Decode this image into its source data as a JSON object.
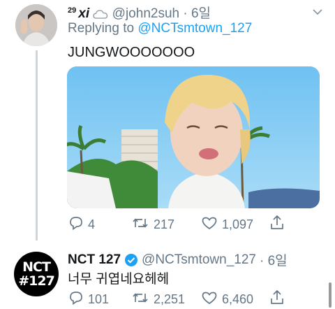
{
  "tweet1": {
    "rank": "29",
    "name": "xi",
    "handle": "@john2suh",
    "time": "· 6일",
    "replying_prefix": "Replying to",
    "replying_handle": "@NCTsmtown_127",
    "text": "JUNGWOOOOOOO",
    "replies": "4",
    "retweets": "217",
    "likes": "1,097"
  },
  "tweet2": {
    "name": "NCT 127",
    "verified": true,
    "handle": "@NCTsmtown_127",
    "time": "· 6일",
    "text": "너무 귀엽네요헤헤",
    "avatar_line1": "NCT",
    "avatar_line2": "#127",
    "replies": "101",
    "retweets": "2,251",
    "likes": "6,460"
  },
  "colors": {
    "accent": "#1da1f2",
    "secondary_text": "#657786",
    "thread_line": "#ccd6dd"
  },
  "icons": [
    "cloud-icon",
    "chevron-down-icon",
    "reply-icon",
    "retweet-icon",
    "like-icon",
    "share-icon",
    "verified-badge-icon"
  ]
}
